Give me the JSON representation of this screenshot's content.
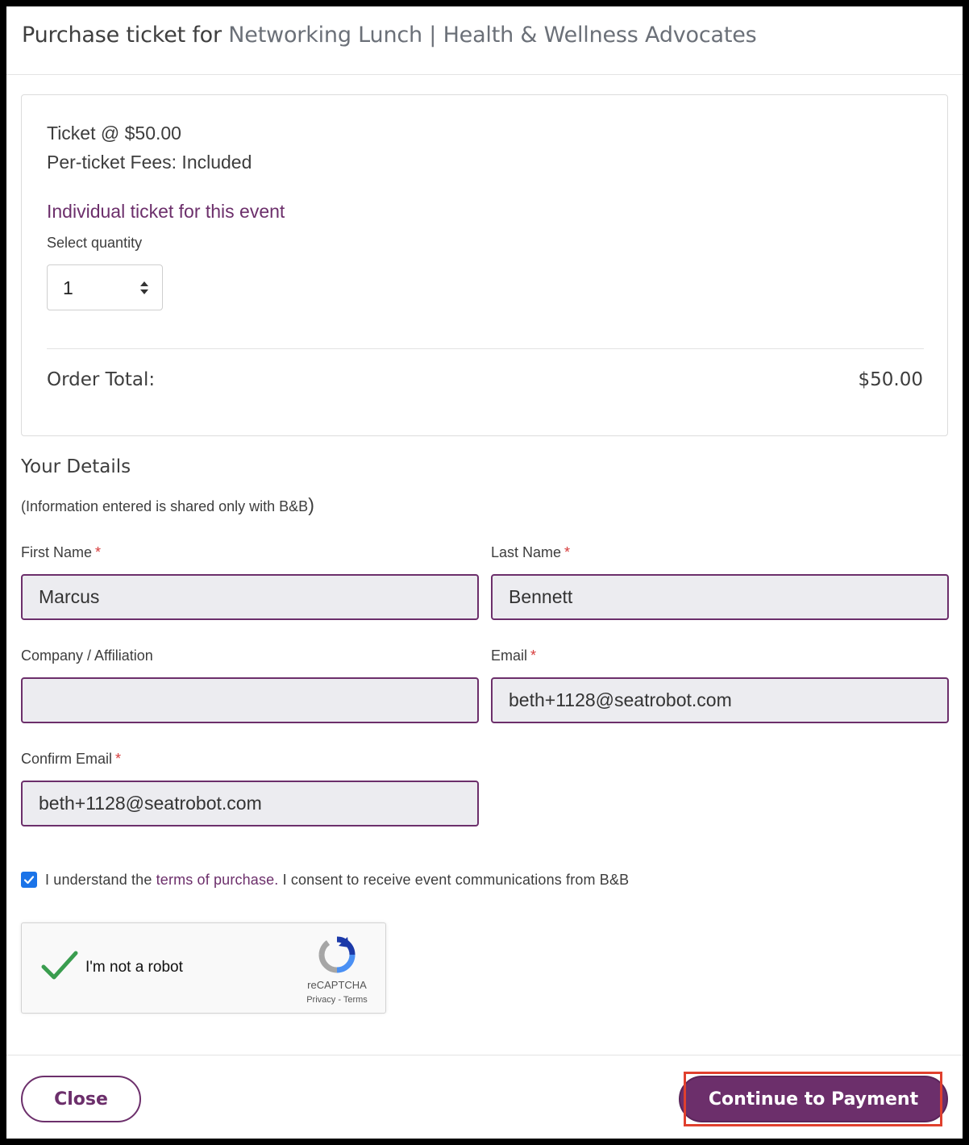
{
  "modal": {
    "title_prefix": "Purchase ticket for",
    "title_event": "Networking Lunch | Health & Wellness Advocates"
  },
  "ticket": {
    "price_line": "Ticket @ $50.00",
    "fees_line": "Per-ticket Fees: Included",
    "type": "Individual ticket for this event",
    "quantity_label": "Select quantity",
    "quantity_value": "1",
    "order_total_label": "Order Total:",
    "order_total_value": "$50.00"
  },
  "details": {
    "title": "Your Details",
    "note": "(Information entered is shared only with B&B",
    "note_close": ")",
    "required_mark": "*",
    "fields": {
      "first_name": {
        "label": "First Name",
        "value": "Marcus"
      },
      "last_name": {
        "label": "Last Name",
        "value": "Bennett"
      },
      "company": {
        "label": "Company / Affiliation",
        "value": ""
      },
      "email": {
        "label": "Email",
        "value": "beth+1128@seatrobot.com"
      },
      "confirm_email": {
        "label": "Confirm Email",
        "value": "beth+1128@seatrobot.com"
      }
    }
  },
  "consent": {
    "checked": true,
    "text_before": "I understand the ",
    "link": "terms of purchase.",
    "text_after": " I consent to receive event communications from B&B"
  },
  "recaptcha": {
    "label": "I'm not a robot",
    "brand": "reCAPTCHA",
    "links": "Privacy - Terms"
  },
  "buttons": {
    "close": "Close",
    "continue": "Continue to Payment"
  },
  "colors": {
    "brand": "#6c2f6b",
    "required": "#d63b3b",
    "highlight": "#e0402e"
  }
}
